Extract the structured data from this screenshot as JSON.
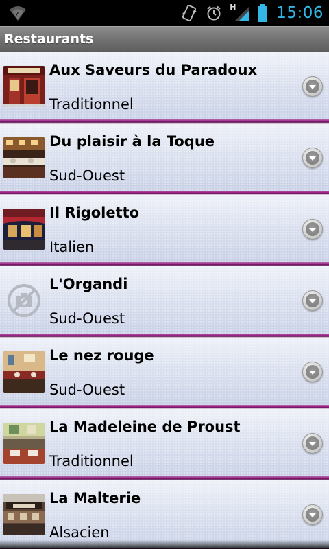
{
  "status_bar": {
    "time": "15:06",
    "network_type": "H",
    "icons": [
      "wifi-icon",
      "vibrate-icon",
      "alarm-icon",
      "signal-icon",
      "battery-icon"
    ]
  },
  "title_bar": {
    "title": "Restaurants"
  },
  "restaurants": [
    {
      "name": "Aux Saveurs du Paradoux",
      "cuisine": "Traditionnel",
      "thumbnail": "photo"
    },
    {
      "name": "Du plaisir à la Toque",
      "cuisine": "Sud-Ouest",
      "thumbnail": "photo"
    },
    {
      "name": "Il Rigoletto",
      "cuisine": "Italien",
      "thumbnail": "photo"
    },
    {
      "name": "L'Organdi",
      "cuisine": "Sud-Ouest",
      "thumbnail": "no-photo-icon"
    },
    {
      "name": "Le nez rouge",
      "cuisine": "Sud-Ouest",
      "thumbnail": "photo"
    },
    {
      "name": "La Madeleine de Proust",
      "cuisine": "Traditionnel",
      "thumbnail": "photo"
    },
    {
      "name": "La Malterie",
      "cuisine": "Alsacien",
      "thumbnail": "photo"
    }
  ],
  "colors": {
    "status_accent": "#33b5e5",
    "row_separator": "#9b1f86",
    "title_bar": "#767676"
  }
}
